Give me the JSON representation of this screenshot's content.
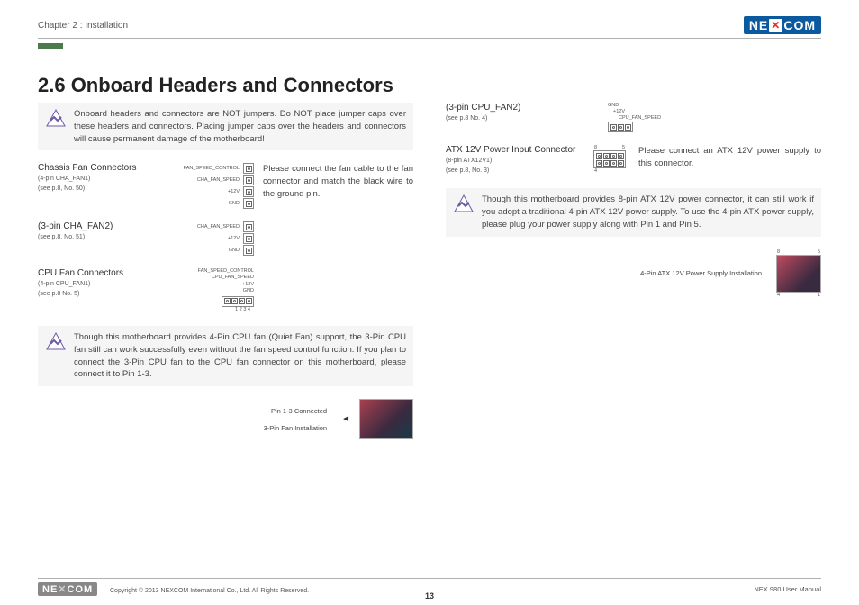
{
  "header": {
    "chapter": "Chapter 2 : Installation",
    "logo_text": "NE COM"
  },
  "title": "2.6 Onboard Headers and Connectors",
  "left": {
    "warn1": "Onboard headers and connectors are NOT jumpers. Do NOT place jumper caps over these headers and connectors. Placing jumper caps over the headers and connectors will cause permanent damage of the motherboard!",
    "chassis": {
      "title": "Chassis Fan Connectors",
      "sub1": "(4-pin CHA_FAN1)",
      "sub2": "(see p.8, No. 50)",
      "pins": [
        "FAN_SPEED_CONTROL",
        "CHA_FAN_SPEED",
        "+12V",
        "GND"
      ],
      "desc": "Please connect the fan cable to the fan connector and match the black wire to the ground pin."
    },
    "cha3": {
      "title": "(3-pin CHA_FAN2)",
      "sub": "(see p.8, No. 51)",
      "pins": [
        "CHA_FAN_SPEED",
        "+12V",
        "GND"
      ]
    },
    "cpu": {
      "title": "CPU Fan Connectors",
      "sub1": "(4-pin CPU_FAN1)",
      "sub2": "(see p.8 No. 5)",
      "pins": [
        "FAN_SPEED_CONTROL",
        "CPU_FAN_SPEED",
        "+12V",
        "GND"
      ],
      "nums": "1 2 3 4"
    },
    "warn2": "Though this motherboard provides 4-Pin CPU fan (Quiet Fan) support, the 3-Pin CPU fan still can work successfully even without the fan speed control function. If you plan to connect the 3-Pin CPU fan to the CPU fan connector on this  motherboard, please connect it to Pin 1-3.",
    "pin13": "Pin 1-3 Connected",
    "install": "3-Pin Fan Installation"
  },
  "right": {
    "cpu3": {
      "title": "(3-pin CPU_FAN2)",
      "sub": "(see p.8 No. 4)",
      "pins": [
        "GND",
        "+12V",
        "CPU_FAN_SPEED"
      ]
    },
    "atx": {
      "title": "ATX 12V Power Input Connector",
      "sub1": "(8-pin ATX12V1)",
      "sub2": "(see p.8, No. 3)",
      "desc": "Please connect an ATX 12V power supply to this connector.",
      "p8": "8",
      "p5": "5",
      "p4": "4"
    },
    "warn3": "Though this motherboard provides 8-pin ATX 12V power connector, it can still work if you adopt a traditional 4-pin ATX 12V power supply. To use the 4-pin ATX power supply, please plug your power supply along with Pin 1 and Pin 5.",
    "install4": "4-Pin ATX 12V Power Supply Installation",
    "p8b": "8",
    "p5b": "5",
    "p4b": "4",
    "p1b": "1"
  },
  "footer": {
    "copy": "Copyright © 2013 NEXCOM International Co., Ltd. All Rights Reserved.",
    "page": "13",
    "doc": "NEX 980 User Manual"
  }
}
